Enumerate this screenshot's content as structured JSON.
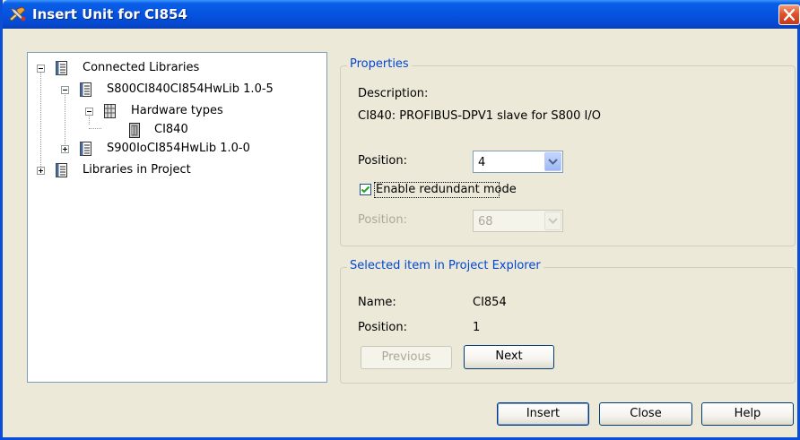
{
  "window": {
    "title": "Insert Unit for CI854",
    "title_icon": "wrench-app-icon",
    "close_icon": "close-icon",
    "accent": "#0553E0"
  },
  "tree": {
    "items": [
      {
        "label": "Connected Libraries",
        "expander": "minus",
        "icon": "library-icon"
      },
      {
        "label": "S800CI840CI854HwLib 1.0-5",
        "expander": "minus",
        "icon": "library-icon"
      },
      {
        "label": "Hardware types",
        "expander": "minus",
        "icon": "hardware-types-icon"
      },
      {
        "label": "CI840",
        "expander": "none",
        "icon": "hardware-unit-icon"
      },
      {
        "label": "S900IoCI854HwLib 1.0-0",
        "expander": "plus",
        "icon": "library-icon"
      },
      {
        "label": "Libraries in Project",
        "expander": "plus",
        "icon": "library-icon"
      }
    ]
  },
  "properties": {
    "legend": "Properties",
    "description_label": "Description:",
    "description_value": "CI840: PROFIBUS-DPV1 slave for S800 I/O",
    "position_label": "Position:",
    "position_value": "4",
    "redundant_label": "Enable redundant mode",
    "redundant_checked": true,
    "redundant_position_label": "Position:",
    "redundant_position_value": "68"
  },
  "selected": {
    "legend": "Selected item in Project Explorer",
    "name_label": "Name:",
    "name_value": "CI854",
    "position_label": "Position:",
    "position_value": "1",
    "previous_label": "Previous",
    "next_label": "Next"
  },
  "buttons": {
    "insert": "Insert",
    "close": "Close",
    "help": "Help"
  }
}
